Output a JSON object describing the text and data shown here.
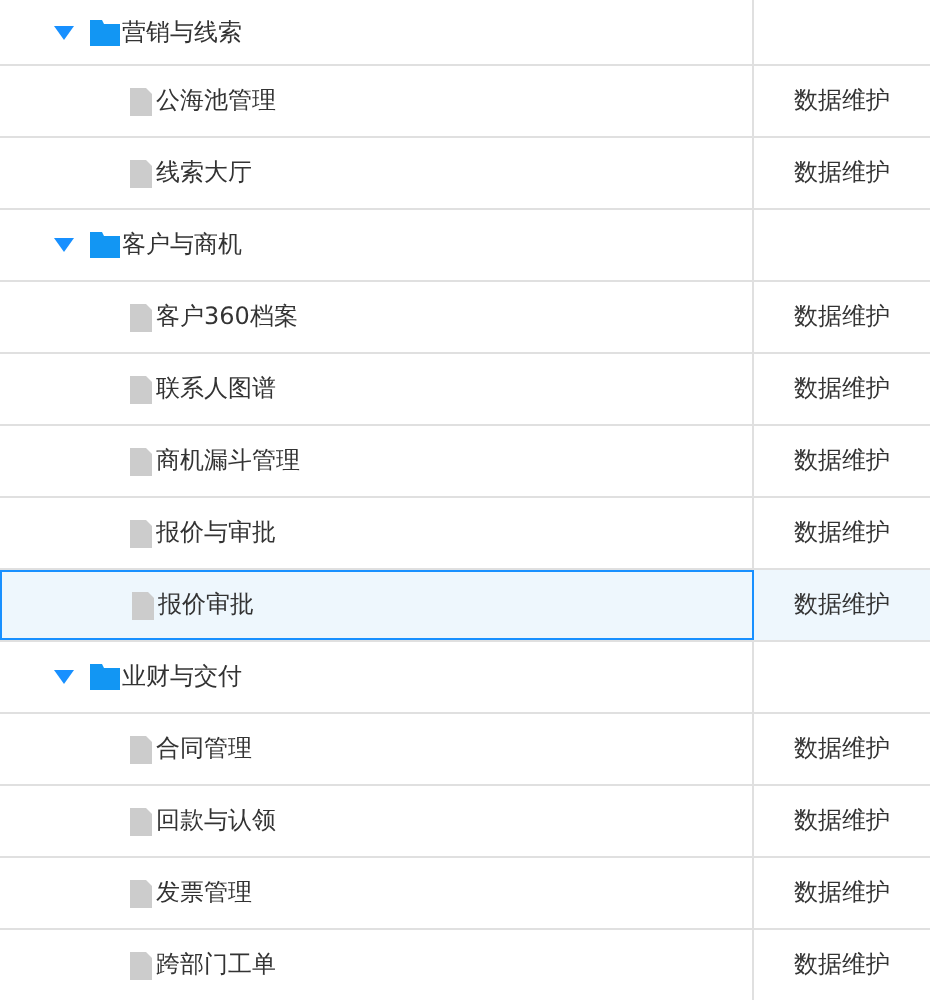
{
  "tree": [
    {
      "label": "营销与线索",
      "expanded": true,
      "children": [
        {
          "label": "公海池管理",
          "action": "数据维护",
          "selected": false
        },
        {
          "label": "线索大厅",
          "action": "数据维护",
          "selected": false
        }
      ]
    },
    {
      "label": "客户与商机",
      "expanded": true,
      "children": [
        {
          "label": "客户360档案",
          "action": "数据维护",
          "selected": false
        },
        {
          "label": "联系人图谱",
          "action": "数据维护",
          "selected": false
        },
        {
          "label": "商机漏斗管理",
          "action": "数据维护",
          "selected": false
        },
        {
          "label": "报价与审批",
          "action": "数据维护",
          "selected": false
        },
        {
          "label": "报价审批",
          "action": "数据维护",
          "selected": true
        }
      ]
    },
    {
      "label": "业财与交付",
      "expanded": true,
      "children": [
        {
          "label": "合同管理",
          "action": "数据维护",
          "selected": false
        },
        {
          "label": "回款与认领",
          "action": "数据维护",
          "selected": false
        },
        {
          "label": "发票管理",
          "action": "数据维护",
          "selected": false
        },
        {
          "label": "跨部门工单",
          "action": "数据维护",
          "selected": false
        }
      ]
    }
  ]
}
